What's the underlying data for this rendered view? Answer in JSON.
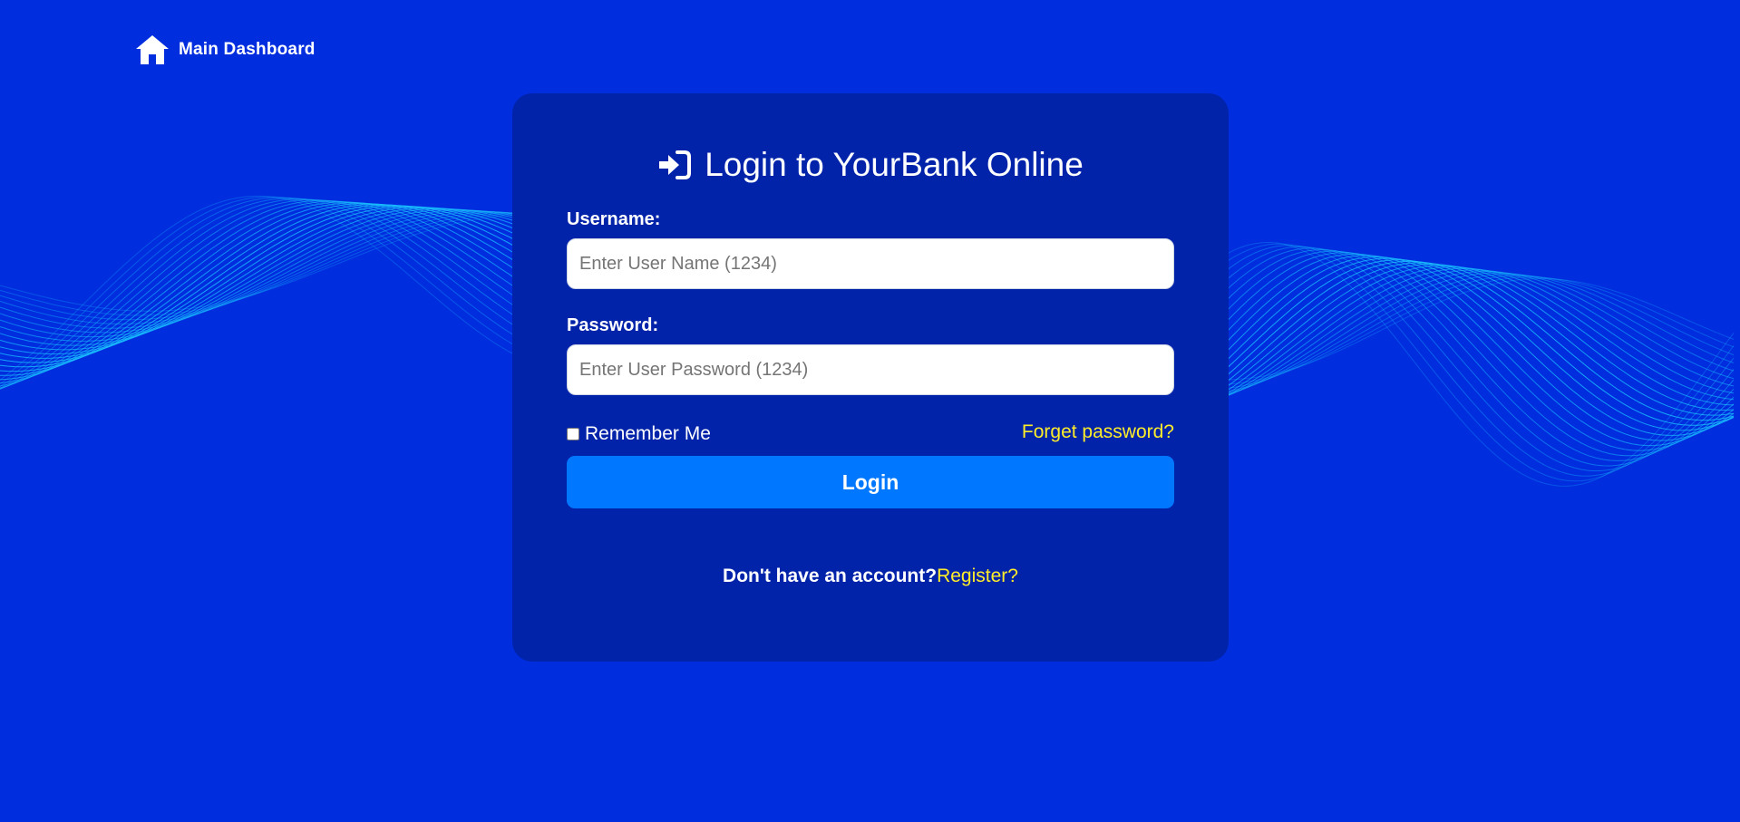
{
  "nav": {
    "home_label": "Main Dashboard"
  },
  "login": {
    "title": "Login to YourBank Online",
    "username_label": "Username:",
    "username_placeholder": "Enter User Name (1234)",
    "password_label": "Password:",
    "password_placeholder": "Enter User Password (1234)",
    "remember_label": "Remember Me",
    "remember_checked": false,
    "forgot_label": "Forget password?",
    "submit_label": "Login",
    "register_prompt": "Don't have an account?",
    "register_link": "Register?"
  },
  "icons": {
    "home": "home-icon",
    "login": "sign-in-icon"
  },
  "colors": {
    "background": "#002edf",
    "card": "#0123aa",
    "button": "#0077ff",
    "link_accent": "#ffed2a",
    "wave": "#1bc6ff"
  }
}
